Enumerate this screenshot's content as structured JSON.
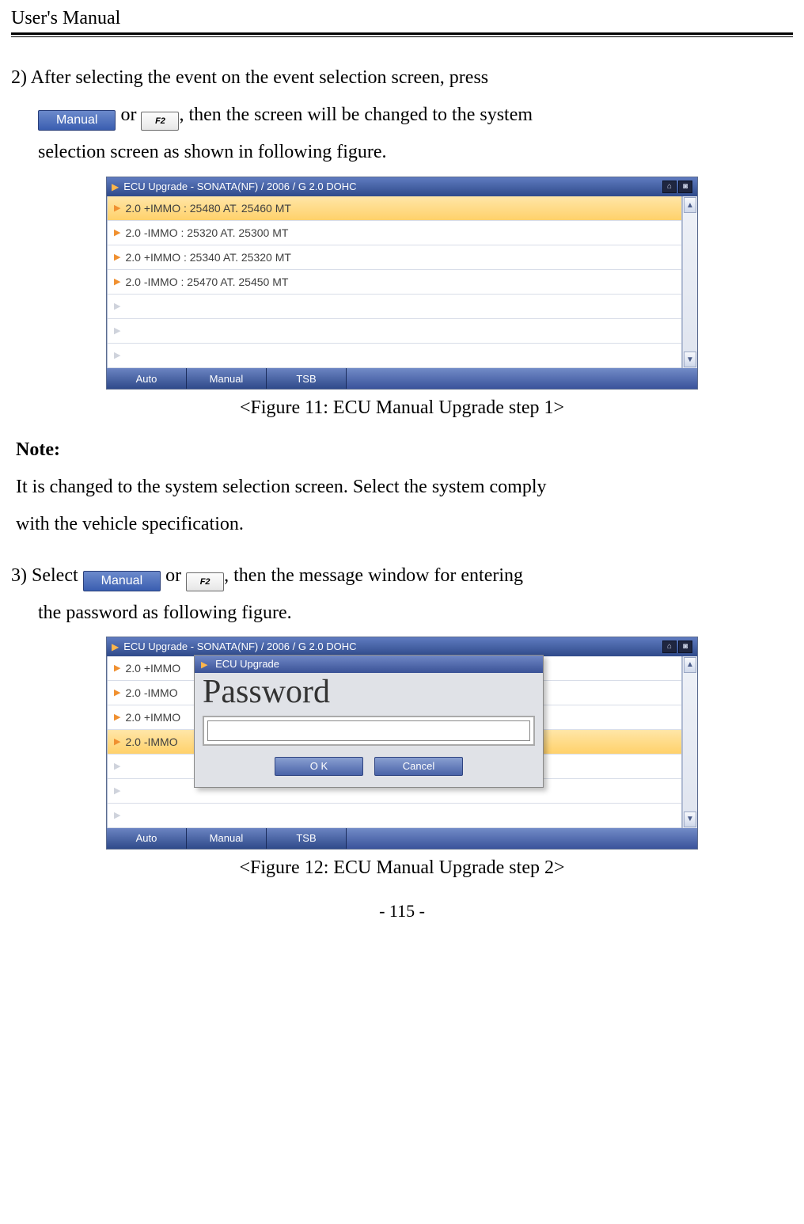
{
  "header": {
    "title": "User's Manual"
  },
  "step2": {
    "prefix": "2)",
    "line1_a": "After  selecting  the  event  on  the  event  selection  screen,  press",
    "btn_manual": "Manual",
    "f2": "F2",
    "line1_b": " or ",
    "line1_c": ", then the screen will be changed to the system",
    "line2": "selection screen as shown in following figure."
  },
  "shot1": {
    "title": "ECU Upgrade - SONATA(NF) / 2006 / G 2.0 DOHC",
    "rows": [
      "2.0 +IMMO : 25480 AT. 25460 MT",
      "2.0 -IMMO : 25320 AT. 25300 MT",
      "2.0 +IMMO : 25340 AT. 25320 MT",
      "2.0 -IMMO : 25470 AT. 25450 MT"
    ],
    "tabs": {
      "auto": "Auto",
      "manual": "Manual",
      "tsb": "TSB"
    }
  },
  "caption1": "<Figure 11: ECU Manual Upgrade step 1>",
  "note": {
    "title": "Note:",
    "line1": "It is changed to the system selection screen. Select the system comply",
    "line2": "with the vehicle specification."
  },
  "step3": {
    "prefix": "3)",
    "a": "Select ",
    "btn_manual": "Manual",
    "b": " or ",
    "f2": "F2",
    "c": ",  then  the  message  window  for  entering",
    "line2": "the password as following figure."
  },
  "shot2": {
    "title": "ECU Upgrade - SONATA(NF) / 2006 / G 2.0 DOHC",
    "rows_left": [
      "2.0 +IMMO",
      "2.0 -IMMO",
      "2.0 +IMMO",
      "2.0 -IMMO"
    ],
    "dialog": {
      "title": "ECU Upgrade",
      "label": "Password",
      "ok": "O K",
      "cancel": "Cancel"
    },
    "tabs": {
      "auto": "Auto",
      "manual": "Manual",
      "tsb": "TSB"
    }
  },
  "caption2": "<Figure 12: ECU Manual Upgrade step 2>",
  "footer": "- 115 -"
}
